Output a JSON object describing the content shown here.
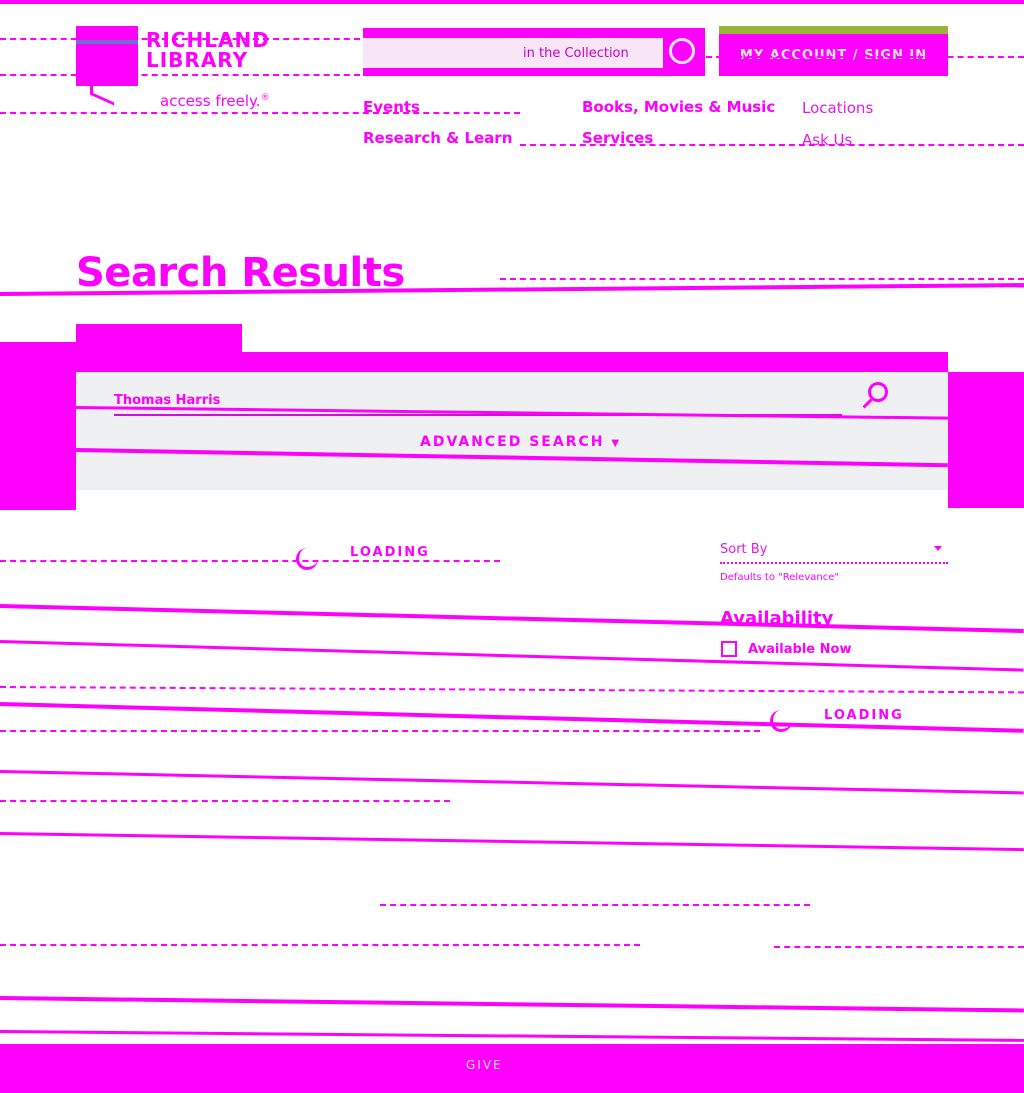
{
  "header": {
    "logo_line1": "RICHLAND",
    "logo_line2": "LIBRARY",
    "tagline": "access freely.",
    "tagline_mark": "®",
    "search_scope": "in the Collection",
    "signin_label": "MY ACCOUNT / SIGN IN"
  },
  "nav": {
    "events": "Events",
    "books": "Books, Movies & Music",
    "locations": "Locations",
    "research": "Research & Learn",
    "services": "Services",
    "ask": "Ask Us"
  },
  "page": {
    "title": "Search Results"
  },
  "search": {
    "query": "Thomas Harris",
    "advanced_label": "ADVANCED SEARCH"
  },
  "results": {
    "loading_label": "LOADING"
  },
  "sidebar": {
    "sort_label": "Sort By",
    "sort_hint": "Defaults to \"Relevance\"",
    "availability_heading": "Availability",
    "available_now_label": "Available Now",
    "loading_label": "LOADING"
  },
  "footer": {
    "text": "GIVE"
  },
  "colors": {
    "accent": "#ff00ff",
    "panel": "#eef0f2",
    "signin_highlight": "#9ab43a"
  },
  "icons": [
    "search-icon",
    "chevron-down-icon",
    "checkbox-icon",
    "spinner-icon",
    "logo-mark-icon"
  ]
}
